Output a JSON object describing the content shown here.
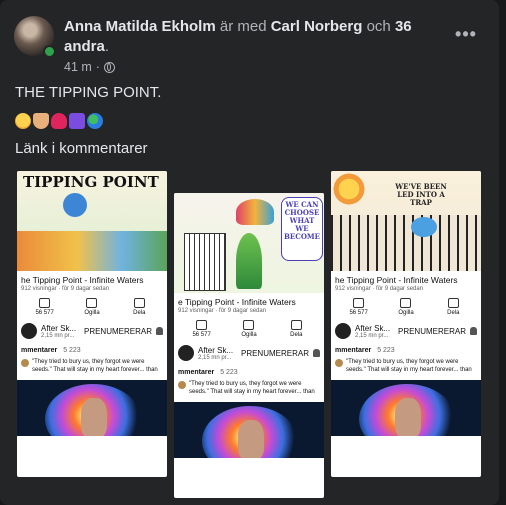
{
  "post": {
    "author": "Anna Matilda Ekholm",
    "with_text": " är med ",
    "tagged": "Carl Norberg",
    "and_text": " och ",
    "others": "36 andra",
    "period": ".",
    "time": "41 m",
    "dot": "·",
    "more": "•••",
    "title": "THE TIPPING POINT.",
    "link_text": "Länk i kommentarer",
    "emojis": [
      "smiling-face-with-hearts",
      "folded-hands",
      "red-heart",
      "sparkles",
      "globe"
    ]
  },
  "thumbs": [
    {
      "art_title": "TIPPING POINT",
      "video_title": "he Tipping Point - Infinite Waters",
      "views": "912 visningar · för 9 dagar sedan",
      "actions": [
        "56 577",
        "Ogilla",
        "Dela"
      ],
      "channel": "After Sk...",
      "channel_sub": "2,15 mn pr...",
      "subscribe": "PRENUMERERAR",
      "comments_label": "mmentarer",
      "comments_count": "5 223",
      "quote": "\"They tried to bury us, they forgot we were seeds.\" That will stay in my heart forever... than"
    },
    {
      "art_title": "WE CAN CHOOSE WHAT WE BECOME",
      "video_title": "e Tipping Point - Infinite Waters",
      "views": "912 visningar · för 9 dagar sedan",
      "actions": [
        "56 577",
        "Ogilla",
        "Dela"
      ],
      "channel": "After Sk...",
      "channel_sub": "2,15 mn pr...",
      "subscribe": "PRENUMERERAR",
      "comments_label": "mmentarer",
      "comments_count": "5 223",
      "quote": "\"They tried to bury us, they forgot we were seeds.\" That will stay in my heart forever... than"
    },
    {
      "art_title": "WE'VE BEEN LED INTO A TRAP",
      "video_title": "he Tipping Point - Infinite Waters",
      "views": "912 visningar · för 9 dagar sedan",
      "actions": [
        "56 577",
        "Ogilla",
        "Dela"
      ],
      "channel": "After Sk...",
      "channel_sub": "2,15 mn pr...",
      "subscribe": "PRENUMERERAR",
      "comments_label": "mmentarer",
      "comments_count": "5 223",
      "quote": "\"They tried to bury us, they forgot we were seeds.\" That will stay in my heart forever... than"
    }
  ]
}
